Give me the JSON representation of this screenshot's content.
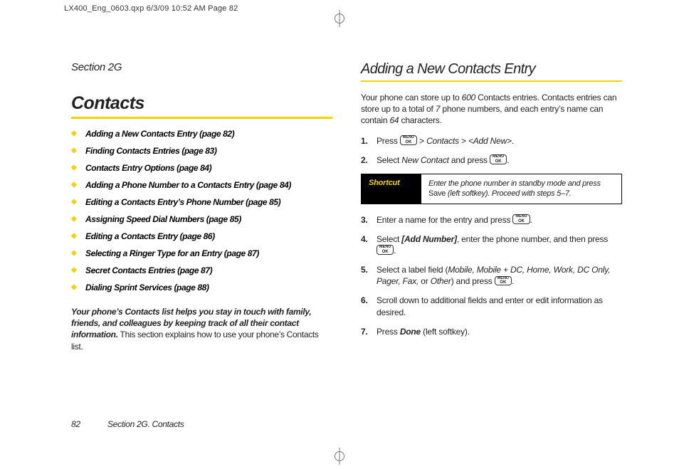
{
  "print_header": "LX400_Eng_0603.qxp  6/3/09  10:52 AM  Page 82",
  "left": {
    "section_label": "Section 2G",
    "title": "Contacts",
    "toc": [
      "Adding a New Contacts Entry (page 82)",
      "Finding Contacts Entries (page 83)",
      "Contacts Entry Options (page 84)",
      "Adding a Phone Number to a Contacts Entry (page 84)",
      "Editing a Contacts Entry’s Phone Number (page 85)",
      "Assigning Speed Dial Numbers (page 85)",
      "Editing a Contacts Entry (page 86)",
      "Selecting a Ringer Type for an Entry (page 87)",
      "Secret Contacts Entries (page 87)",
      "Dialing Sprint Services (page 88)"
    ],
    "intro_bold": "Your phone’s Contacts list helps you stay in touch with family, friends, and colleagues by keeping track of all their contact information.",
    "intro_plain": " This section explains how to use your phone’s Contacts list."
  },
  "right": {
    "subtitle": "Adding a New Contacts Entry",
    "lead_pre": "Your phone can store up to ",
    "lead_600": "600",
    "lead_mid": " Contacts entries. Contacts entries can store up to a total of ",
    "lead_7": "7",
    "lead_mid2": " phone numbers, and each entry’s name can contain ",
    "lead_64": "64",
    "lead_post": " characters.",
    "step1_pre": "Press ",
    "step1_gt": " > ",
    "step1_contacts": "Contacts",
    "step1_gt2": " > ",
    "step1_addnew": "<Add New>",
    "step1_end": ".",
    "step2_pre": "Select ",
    "step2_nc": "New Contact",
    "step2_mid": " and press ",
    "step2_end": ".",
    "shortcut_label": "Shortcut",
    "shortcut_pre": "Enter the phone number in standby mode and press ",
    "shortcut_save": "Save",
    "shortcut_post": " (left softkey). Proceed with steps 5–7.",
    "step3_pre": "Enter a name for the entry and press ",
    "step3_end": ".",
    "step4_pre": "Select ",
    "step4_addnum": "[Add Number]",
    "step4_mid": ", enter the phone number, and then press ",
    "step4_end": ".",
    "step5_pre": "Select a label field (",
    "step5_labels": "Mobile, Mobile + DC, Home, Work, DC Only, Pager, Fax,",
    "step5_or": " or ",
    "step5_other": "Other",
    "step5_mid": ") and press ",
    "step5_end": ".",
    "step6": "Scroll down to additional fields and enter or edit information as desired.",
    "step7_pre": "Press ",
    "step7_done": "Done",
    "step7_post": " (left softkey)."
  },
  "footer": {
    "page_number": "82",
    "section_ref": "Section 2G. Contacts"
  },
  "key": {
    "line1": "MENU",
    "line2": "OK"
  }
}
